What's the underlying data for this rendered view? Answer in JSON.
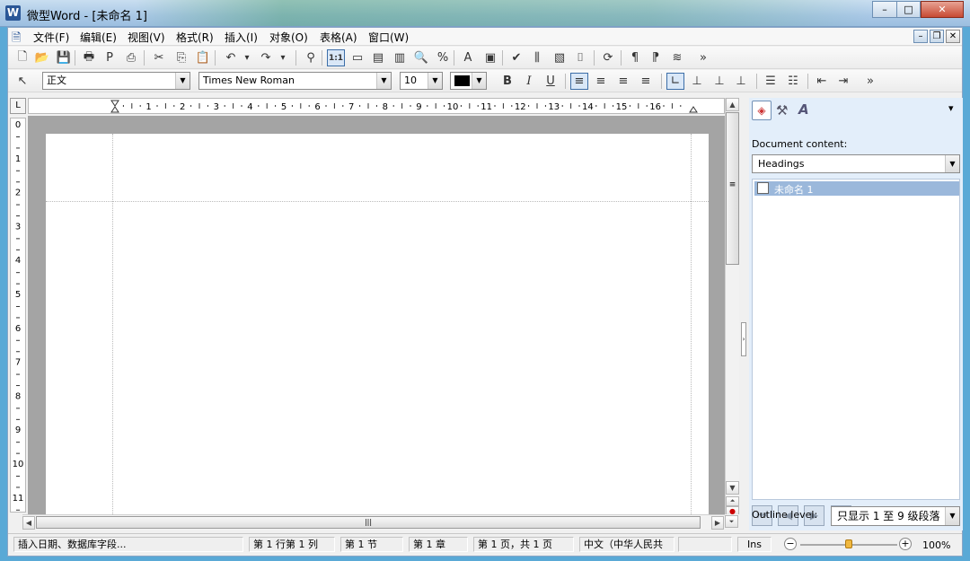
{
  "window": {
    "title": "微型Word - [未命名 1]",
    "app_icon_letter": "W",
    "buttons": {
      "minimize": "–",
      "maximize": "□",
      "close": "✕"
    }
  },
  "mdi_buttons": {
    "minimize": "–",
    "restore": "❐",
    "close": "✕"
  },
  "menu": [
    {
      "label": "文件(F)"
    },
    {
      "label": "编辑(E)"
    },
    {
      "label": "视图(V)"
    },
    {
      "label": "格式(R)"
    },
    {
      "label": "插入(I)"
    },
    {
      "label": "对象(O)"
    },
    {
      "label": "表格(A)"
    },
    {
      "label": "窗口(W)"
    }
  ],
  "toolbar1": [
    {
      "name": "new-doc-icon",
      "glyph": "🗋"
    },
    {
      "name": "open-folder-icon",
      "glyph": "📂"
    },
    {
      "name": "save-icon",
      "glyph": "💾"
    },
    {
      "name": "print-icon",
      "glyph": "🖶"
    },
    {
      "name": "pdf-icon",
      "glyph": "P"
    },
    {
      "name": "print-preview-icon",
      "glyph": "⎙"
    },
    {
      "name": "cut-icon",
      "glyph": "✂"
    },
    {
      "name": "copy-icon",
      "glyph": "⎘"
    },
    {
      "name": "paste-icon",
      "glyph": "📋"
    },
    {
      "name": "undo-icon",
      "glyph": "↶"
    },
    {
      "name": "undo-dropdown-icon",
      "glyph": "▾"
    },
    {
      "name": "redo-icon",
      "glyph": "↷"
    },
    {
      "name": "redo-dropdown-icon",
      "glyph": "▾"
    },
    {
      "name": "find-binoculars-icon",
      "glyph": "⚲"
    },
    {
      "name": "page-view-icon",
      "glyph": "1:1"
    },
    {
      "name": "web-view-icon",
      "glyph": "▭"
    },
    {
      "name": "outline-view-icon",
      "glyph": "▤"
    },
    {
      "name": "two-page-icon",
      "glyph": "▥"
    },
    {
      "name": "zoom-icon",
      "glyph": "🔍"
    },
    {
      "name": "zoom-percent-icon",
      "glyph": "%"
    },
    {
      "name": "font-color-a-icon",
      "glyph": "A"
    },
    {
      "name": "text-box-icon",
      "glyph": "▣"
    },
    {
      "name": "spellcheck-icon",
      "glyph": "✔"
    },
    {
      "name": "columns-icon",
      "glyph": "⫼"
    },
    {
      "name": "frame-icon",
      "glyph": "▧"
    },
    {
      "name": "bracket-icon",
      "glyph": "⌷"
    },
    {
      "name": "refresh-icon",
      "glyph": "⟳"
    },
    {
      "name": "pilcrow-icon",
      "glyph": "¶"
    },
    {
      "name": "paragraph-mark-icon",
      "glyph": "⁋"
    },
    {
      "name": "stack-icon",
      "glyph": "≋"
    },
    {
      "name": "more-icon",
      "glyph": "»"
    }
  ],
  "toolbar2": {
    "style_value": "正文",
    "font_value": "Times New Roman",
    "size_value": "10",
    "text_color": "#000000",
    "buttons": [
      {
        "name": "pointer-icon",
        "glyph": "↖"
      },
      {
        "name": "bold-icon",
        "glyph": "B"
      },
      {
        "name": "italic-icon",
        "glyph": "I"
      },
      {
        "name": "underline-icon",
        "glyph": "U"
      },
      {
        "name": "align-left-icon",
        "glyph": "≡"
      },
      {
        "name": "align-center-icon",
        "glyph": "≡"
      },
      {
        "name": "align-right-icon",
        "glyph": "≡"
      },
      {
        "name": "justify-icon",
        "glyph": "≡"
      },
      {
        "name": "tab-left-icon",
        "glyph": "∟"
      },
      {
        "name": "tab-center-icon",
        "glyph": "⊥"
      },
      {
        "name": "tab-right-icon",
        "glyph": "⊥"
      },
      {
        "name": "tab-decimal-icon",
        "glyph": "⊥"
      },
      {
        "name": "bullet-list-icon",
        "glyph": "☰"
      },
      {
        "name": "numbered-list-icon",
        "glyph": "☷"
      },
      {
        "name": "decrease-indent-icon",
        "glyph": "⇤"
      },
      {
        "name": "increase-indent-icon",
        "glyph": "⇥"
      },
      {
        "name": "more-icon",
        "glyph": "»"
      }
    ]
  },
  "ruler": {
    "corner": "L",
    "h_numbers": [
      "1",
      "2",
      "3",
      "4",
      "5",
      "6",
      "7",
      "8",
      "9",
      "10",
      "11",
      "12",
      "13",
      "14",
      "15",
      "16"
    ],
    "v_numbers": [
      "0",
      "1",
      "2",
      "3",
      "4",
      "5",
      "6",
      "7",
      "8",
      "9",
      "10",
      "11"
    ]
  },
  "panel": {
    "tab_icons": [
      "compass-icon",
      "tools-icon",
      "font-style-icon"
    ],
    "dropdown_arrow": "▾",
    "content_label": "Document content:",
    "content_select": "Headings",
    "tree_items": [
      {
        "label": "未命名 1",
        "checked": false
      }
    ],
    "nav_buttons": [
      "first-icon",
      "prev-icon",
      "next-icon",
      "last-icon"
    ],
    "outline_label": "Outline level:",
    "outline_select": "只显示 1 至 9 级段落"
  },
  "status": {
    "hint": "插入日期、数据库字段...",
    "position": "第 1 行第 1 列",
    "section": "第 1 节",
    "chapter": "第 1 章",
    "pages": "第 1 页，共 1 页",
    "language": "中文（中华人民共",
    "empty": "",
    "mode": "Ins",
    "zoom": "100%",
    "zoom_level": 0.5
  }
}
